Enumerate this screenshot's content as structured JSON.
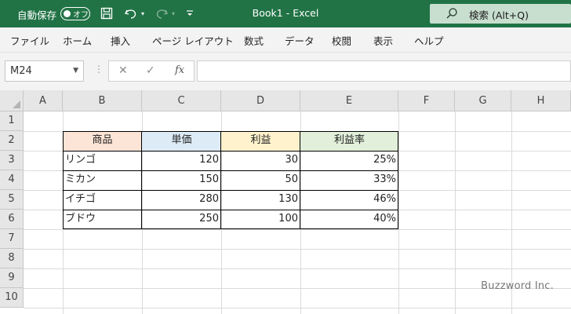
{
  "titlebar": {
    "autosave_label": "自動保存",
    "autosave_state": "オフ",
    "document_title": "Book1  -  Excel",
    "search_placeholder": "検索 (Alt+Q)"
  },
  "ribbon": {
    "tabs": [
      "ファイル",
      "ホーム",
      "挿入",
      "ページ レイアウト",
      "数式",
      "データ",
      "校閲",
      "表示",
      "ヘルプ"
    ]
  },
  "formula_bar": {
    "name_box": "M24",
    "formula": ""
  },
  "sheet": {
    "columns": [
      "A",
      "B",
      "C",
      "D",
      "E",
      "F",
      "G",
      "H"
    ],
    "rows": [
      "1",
      "2",
      "3",
      "4",
      "5",
      "6",
      "7",
      "8",
      "9",
      "10"
    ],
    "table": {
      "headers": [
        "商品",
        "単価",
        "利益",
        "利益率"
      ],
      "header_colors": [
        "#fce4d6",
        "#ddebf7",
        "#fff2cc",
        "#e2efda"
      ],
      "rows": [
        [
          "リンゴ",
          "120",
          "30",
          "25%"
        ],
        [
          "ミカン",
          "150",
          "50",
          "33%"
        ],
        [
          "イチゴ",
          "280",
          "130",
          "46%"
        ],
        [
          "ブドウ",
          "250",
          "100",
          "40%"
        ]
      ]
    }
  },
  "watermark": "Buzzword Inc.",
  "colors": {
    "excel_green": "#217346",
    "search_bg": "#c8dfcf"
  }
}
